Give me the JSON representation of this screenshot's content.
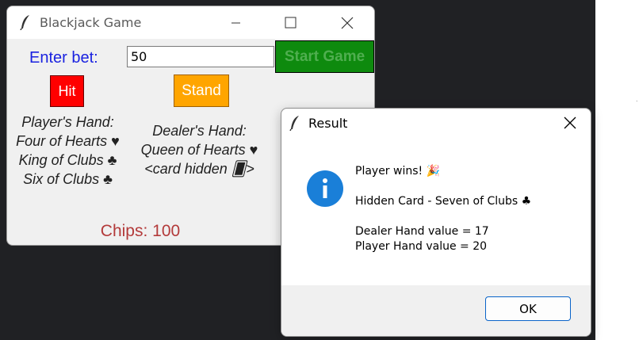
{
  "main_window": {
    "title": "Blackjack Game",
    "bet_label": "Enter bet:",
    "bet_value": "50",
    "start_button": "Start Game",
    "hit_button": "Hit",
    "stand_button": "Stand",
    "player_hand": [
      "Player's Hand:",
      "Four of Hearts ♥",
      "King of Clubs ♣",
      "Six of Clubs ♣"
    ],
    "dealer_hand": [
      "Dealer's Hand:",
      "Queen of Hearts ♥",
      "<card hidden 🂠>"
    ],
    "chips": "Chips: 100",
    "controls": [
      "minimize-icon",
      "maximize-icon",
      "close-icon"
    ]
  },
  "dialog": {
    "title": "Result",
    "icon": "info-icon",
    "message_lines": [
      "Player wins! 🎉",
      "",
      " Hidden Card - Seven of Clubs ♣",
      "",
      " Dealer Hand value = 17",
      " Player Hand value = 20"
    ],
    "ok_button": "OK"
  },
  "colors": {
    "enter_bet": "#1a22e0",
    "start_button_bg": "#0e8a0e",
    "hit_button_bg": "#ff0000",
    "stand_button_bg": "#ffa500",
    "chips": "#b33a3a",
    "info_icon": "#1a7fd8"
  }
}
